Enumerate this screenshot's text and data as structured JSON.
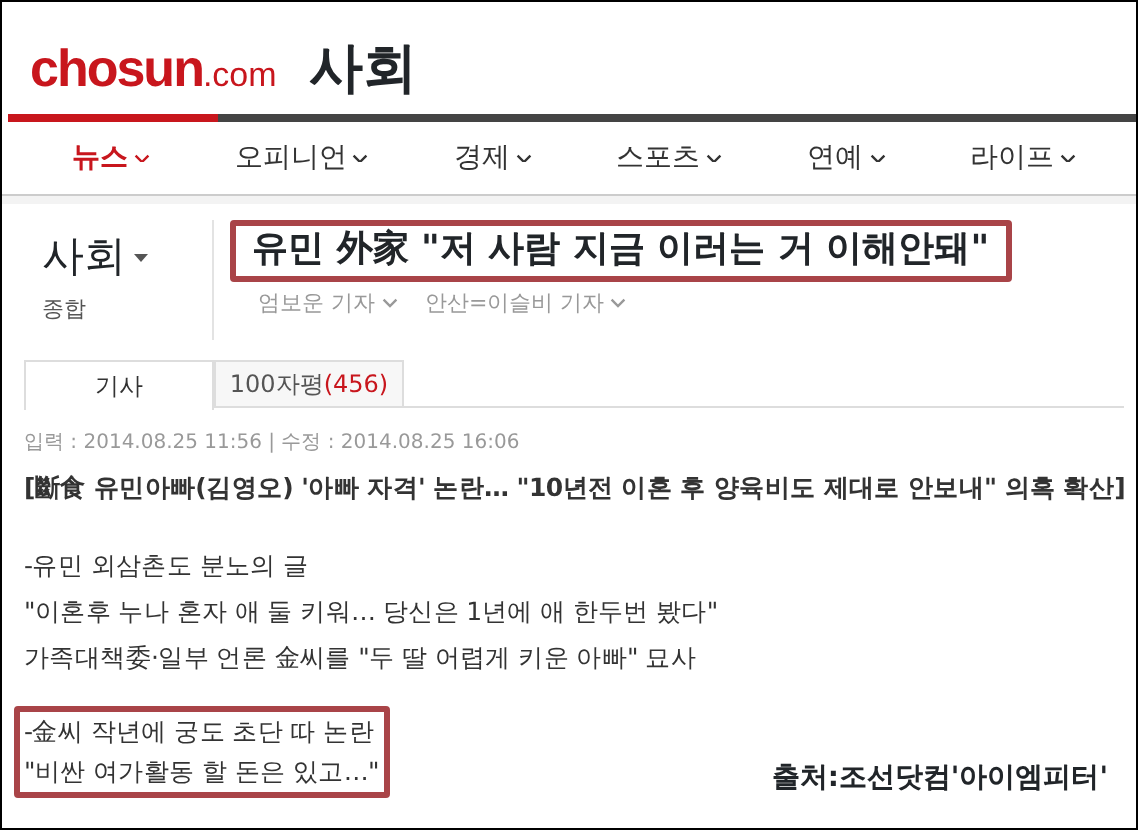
{
  "site": {
    "logo_main": "chosun",
    "logo_suffix": ".com",
    "section_title": "사회"
  },
  "nav": [
    {
      "label": "뉴스",
      "selected": true
    },
    {
      "label": "오피니언",
      "selected": false
    },
    {
      "label": "경제",
      "selected": false
    },
    {
      "label": "스포츠",
      "selected": false
    },
    {
      "label": "연예",
      "selected": false
    },
    {
      "label": "라이프",
      "selected": false
    }
  ],
  "section": {
    "name": "사회",
    "subsection": "종합"
  },
  "headline": {
    "text": "유민 外家 \"저 사람 지금 이러는 거 이해안돼\"",
    "highlighted": true
  },
  "bylines": [
    "엄보운 기자",
    "안산=이슬비 기자"
  ],
  "tabs": [
    {
      "label": "기사",
      "selected": true
    },
    {
      "label": "100자평",
      "count": "(456)",
      "selected": false
    }
  ],
  "dates": "입력 : 2014.08.25 11:56 | 수정 : 2014.08.25 16:06",
  "lede": [
    {
      "lines": [
        "[斷食 유민아빠(김영오) '아빠 자격' 논란… \"10년전 이혼 후 양육비도 제대로 안보내\" 의혹 확산]"
      ],
      "highlighted": false
    },
    {
      "lines": [
        "-유민 외삼촌도 분노의 글",
        "\"이혼후 누나 혼자 애 둘 키워… 당신은 1년에 애 한두번 봤다\"",
        "가족대책委·일부 언론 金씨를 \"두 딸 어렵게 키운 아빠\" 묘사"
      ],
      "highlighted": false
    },
    {
      "lines": [
        "-金씨 작년에 궁도 초단 따 논란",
        "\"비싼 여가활동 할 돈은 있고…\""
      ],
      "highlighted": true
    }
  ],
  "caption": "출처:조선닷컴'아이엠피터'"
}
